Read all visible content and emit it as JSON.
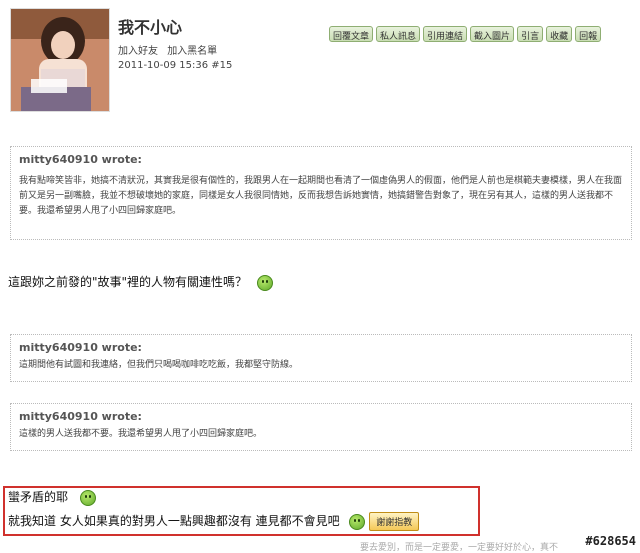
{
  "post": {
    "author": "我不小心",
    "links": [
      "加入好友",
      "加入黑名單"
    ],
    "meta": "2011-10-09 15:36 #15"
  },
  "actions": [
    "回覆文章",
    "私人訊息",
    "引用連結",
    "截入圖片",
    "引言",
    "收藏",
    "回報"
  ],
  "quotes": [
    {
      "who": "mitty640910 wrote:",
      "body": "我有點啼笑皆非，她搞不清狀況，其實我是很有個性的，我跟男人在一起期間也看清了一個虛偽男人的假面，他們是人前也是棋範夫妻模樣，男人在我面前又是另一副嘴臉，我並不想破壞她的家庭，同樣是女人我很同情她，反而我想告訴她實情，她搞錯警告對象了，現在另有其人，這樣的男人送我都不要。我還希望男人甩了小四回歸家庭吧。"
    },
    {
      "who": "mitty640910 wrote:",
      "body": "這期間他有試圖和我連絡，但我們只喝喝咖啡吃吃飯，我都堅守防線。"
    },
    {
      "who": "mitty640910 wrote:",
      "body": "這樣的男人送我都不要。我還希望男人甩了小四回歸家庭吧。"
    }
  ],
  "reply_line": "這跟妳之前發的\"故事\"裡的人物有關連性嗎？",
  "highlight": {
    "line1": "蠻矛盾的耶",
    "line2": "就我知道 女人如果真的對男人一點興趣都沒有 連見都不會見吧",
    "thanks_label": "謝謝指教"
  },
  "footer": "要去愛別，而是一定要愛，一定要好好於心，真不",
  "watermark": "#628654",
  "icons": {
    "smiley": "smiley-icon"
  }
}
